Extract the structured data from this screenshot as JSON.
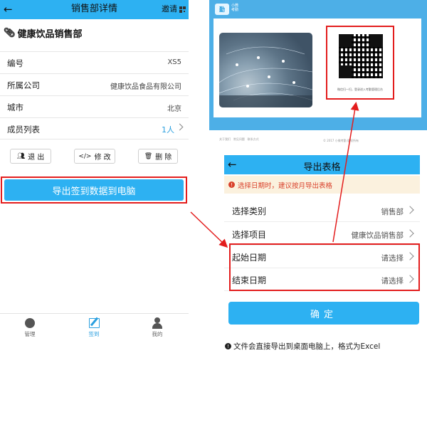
{
  "left": {
    "header": {
      "title": "销售部详情",
      "invite": "邀请"
    },
    "dept_name": "健康饮品销售部",
    "rows": [
      {
        "key": "编号",
        "value": "XS5"
      },
      {
        "key": "所属公司",
        "value": "健康饮品食品有限公司"
      },
      {
        "key": "城市",
        "value": "北京"
      },
      {
        "key": "成员列表",
        "value": "1人"
      }
    ],
    "actions": {
      "exit": "退 出",
      "edit": "修 改",
      "delete": "删 除"
    },
    "export_button": "导出签到数据到电脑",
    "tabs": [
      {
        "label": "管理"
      },
      {
        "label": "签到"
      },
      {
        "label": "我的"
      }
    ]
  },
  "screenshot": {
    "logo_text": "小微\n考勤",
    "qr_caption": "微信扫一扫，登录进入考勤管理后台",
    "footer_links": "关于我们   常见问题   联系方式",
    "copyright": "© 2017 小微考勤 版权所有"
  },
  "panel": {
    "title": "导出表格",
    "warning": "选择日期时，建议按月导出表格",
    "rows": [
      {
        "key": "选择类别",
        "value": "销售部"
      },
      {
        "key": "选择项目",
        "value": "健康饮品销售部"
      },
      {
        "key": "起始日期",
        "value": "请选择"
      },
      {
        "key": "结束日期",
        "value": "请选择"
      }
    ],
    "confirm": "确定",
    "note": "文件会直接导出到桌面电脑上，格式为Excel"
  },
  "colors": {
    "brand_blue": "#2db1f2",
    "highlight_red": "#e31d1d",
    "warning_bg": "#fbf1de"
  }
}
